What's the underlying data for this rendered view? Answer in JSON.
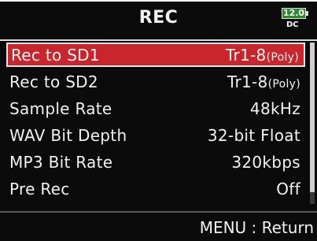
{
  "header": {
    "title": "REC",
    "battery": {
      "voltage": "12.0",
      "source": "DC"
    }
  },
  "menu": {
    "items": [
      {
        "label": "Rec to SD1",
        "value": "Tr1-8",
        "suffix": "(Poly)",
        "selected": true
      },
      {
        "label": "Rec to SD2",
        "value": "Tr1-8",
        "suffix": "(Poly)",
        "selected": false
      },
      {
        "label": "Sample Rate",
        "value": "48kHz",
        "suffix": "",
        "selected": false
      },
      {
        "label": "WAV Bit Depth",
        "value": "32-bit Float",
        "suffix": "",
        "selected": false
      },
      {
        "label": "MP3 Bit Rate",
        "value": "320kbps",
        "suffix": "",
        "selected": false
      },
      {
        "label": "Pre Rec",
        "value": "Off",
        "suffix": "",
        "selected": false
      }
    ]
  },
  "footer": {
    "hint": "MENU : Return"
  },
  "colors": {
    "selection": "#c8262c",
    "background": "#0b0b0b",
    "battery": "#2c8a2c"
  }
}
